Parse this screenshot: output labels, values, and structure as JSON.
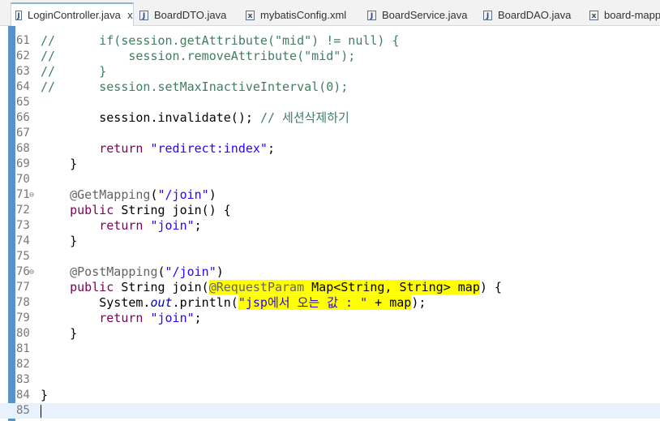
{
  "tabs": [
    {
      "label": "LoginController.java",
      "icon": "java-file-icon",
      "active": true,
      "closable": true
    },
    {
      "label": "BoardDTO.java",
      "icon": "java-file-icon"
    },
    {
      "label": "mybatisConfig.xml",
      "icon": "xml-file-icon"
    },
    {
      "label": "BoardService.java",
      "icon": "java-file-icon"
    },
    {
      "label": "BoardDAO.java",
      "icon": "java-file-icon"
    },
    {
      "label": "board-mappe",
      "icon": "xml-file-icon"
    }
  ],
  "tab_close_glyph": "x",
  "editor": {
    "lines": [
      {
        "num": "61",
        "code": "//      if(session.getAttribute(\"mid\") != null) {"
      },
      {
        "num": "62",
        "code": "//          session.removeAttribute(\"mid\");"
      },
      {
        "num": "63",
        "code": "//      }"
      },
      {
        "num": "64",
        "code": "//      session.setMaxInactiveInterval(0);"
      },
      {
        "num": "65",
        "code": ""
      },
      {
        "num": "66",
        "code": "        session.invalidate(); // 세션삭제하기"
      },
      {
        "num": "67",
        "code": ""
      },
      {
        "num": "68",
        "code": "        return \"redirect:index\";"
      },
      {
        "num": "69",
        "code": "    }"
      },
      {
        "num": "70",
        "code": ""
      },
      {
        "num": "71",
        "code": "    @GetMapping(\"/join\")",
        "fold": true
      },
      {
        "num": "72",
        "code": "    public String join() {"
      },
      {
        "num": "73",
        "code": "        return \"join\";"
      },
      {
        "num": "74",
        "code": "    }"
      },
      {
        "num": "75",
        "code": ""
      },
      {
        "num": "76",
        "code": "    @PostMapping(\"/join\")",
        "fold": true
      },
      {
        "num": "77",
        "code": "    public String join(@RequestParam Map<String, String> map) {"
      },
      {
        "num": "78",
        "code": "        System.out.println(\"jsp에서 오는 값 : \" + map);"
      },
      {
        "num": "79",
        "code": "        return \"join\";"
      },
      {
        "num": "80",
        "code": "    }"
      },
      {
        "num": "81",
        "code": ""
      },
      {
        "num": "82",
        "code": ""
      },
      {
        "num": "83",
        "code": ""
      },
      {
        "num": "84",
        "code": "}"
      },
      {
        "num": "85",
        "code": "",
        "current": true
      }
    ]
  },
  "colors": {
    "comment": "#3f7f5f",
    "keyword": "#7f0055",
    "string": "#2a00ff",
    "annotation": "#646464",
    "static_field": "#0000c0",
    "highlight": "#ffff00",
    "current_line": "#e8f2fe",
    "ruler": "#5a93c8"
  }
}
